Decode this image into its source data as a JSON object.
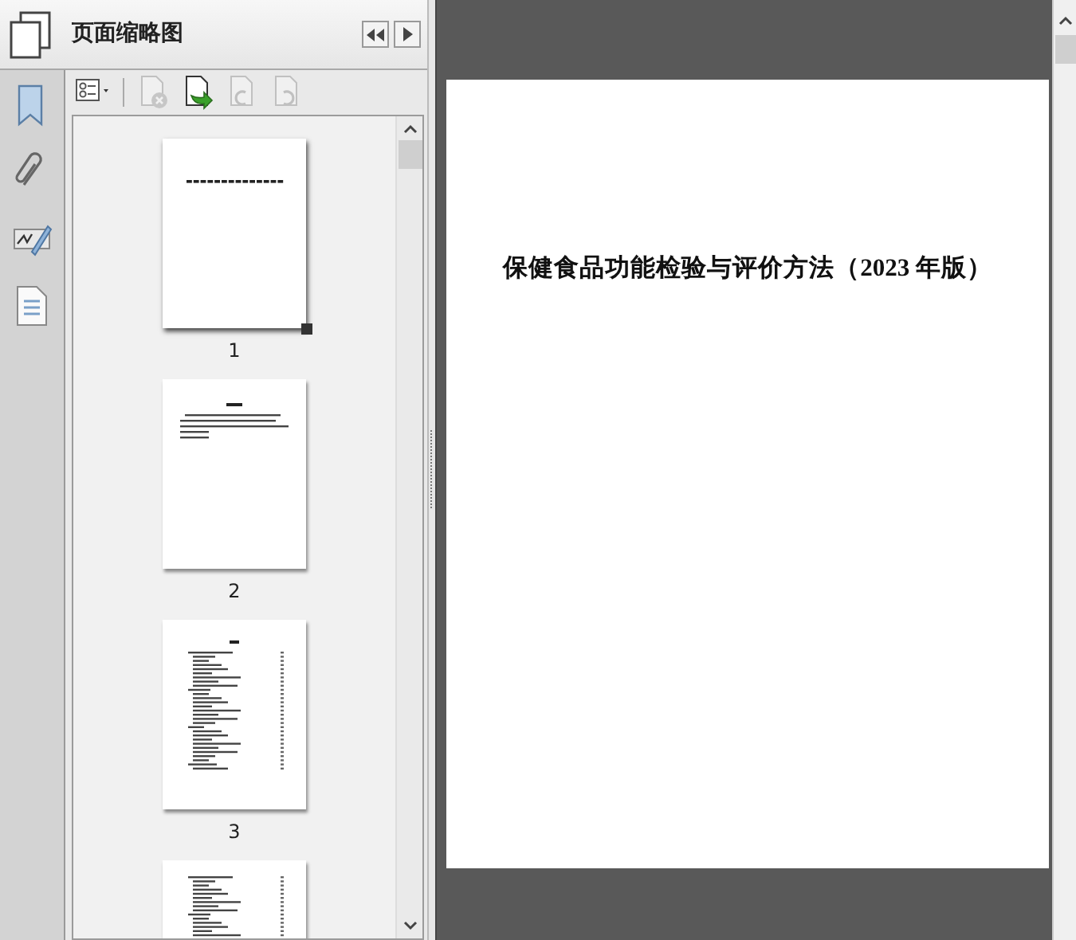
{
  "panel": {
    "title": "页面缩略图"
  },
  "rail": [
    {
      "kind": "bookmarks"
    },
    {
      "kind": "attachments"
    },
    {
      "kind": "signatures"
    },
    {
      "kind": "layers"
    }
  ],
  "toolbar": [
    {
      "kind": "options",
      "disabled": false
    },
    {
      "kind": "delete",
      "disabled": true
    },
    {
      "kind": "insert",
      "disabled": false
    },
    {
      "kind": "rotate-left",
      "disabled": true
    },
    {
      "kind": "rotate-right",
      "disabled": true
    }
  ],
  "thumbnails": [
    {
      "kind": "cover",
      "label": "1",
      "selected": true
    },
    {
      "kind": "text",
      "label": "2",
      "selected": false
    },
    {
      "kind": "toc",
      "label": "3",
      "selected": false
    },
    {
      "kind": "toc-continued",
      "selected": false
    }
  ],
  "document": {
    "title": "保健食品功能检验与评价方法（2023 年版）"
  }
}
